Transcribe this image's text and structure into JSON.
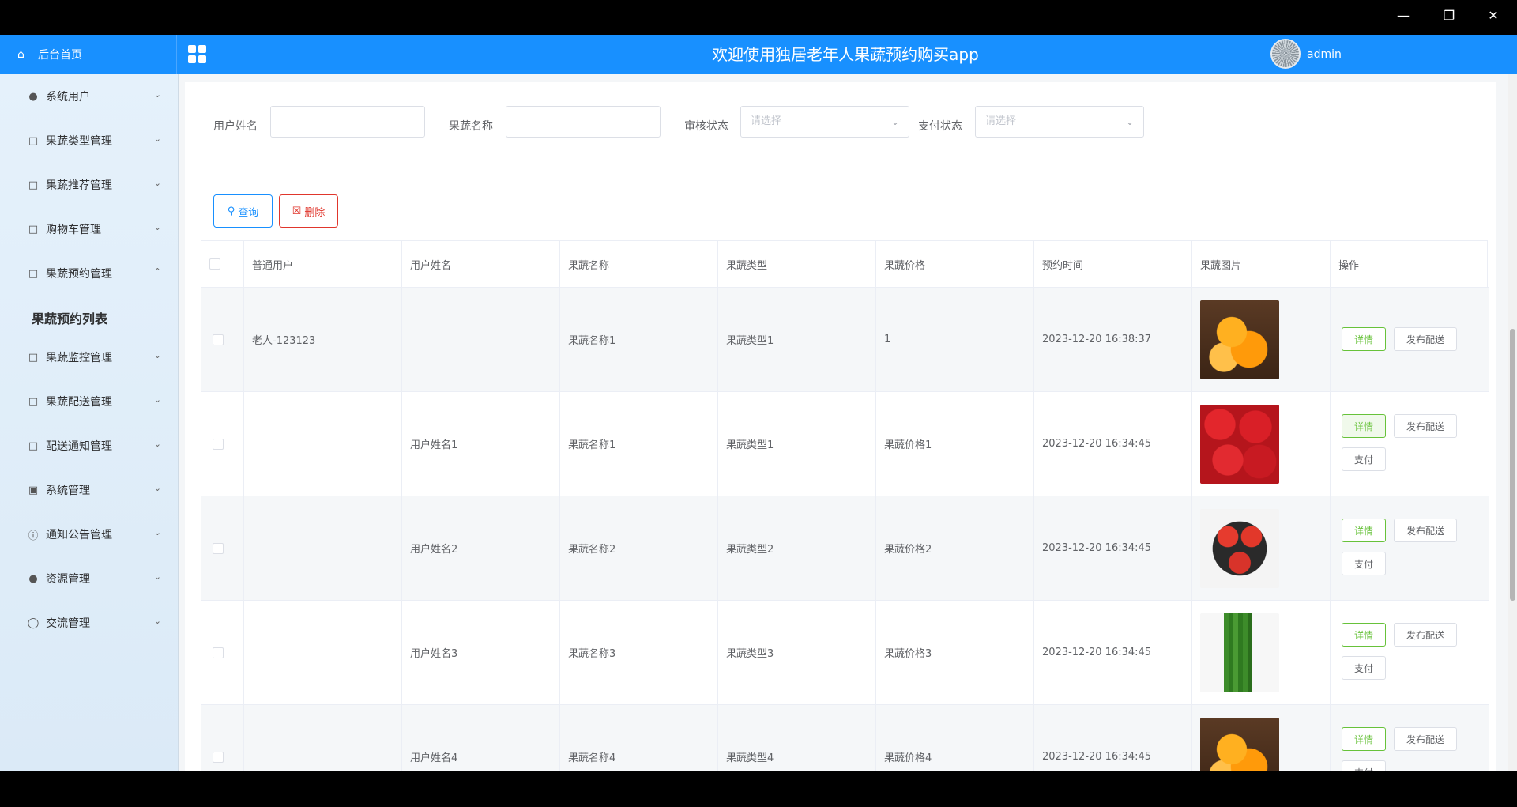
{
  "header": {
    "home_label": "后台首页",
    "title": "欢迎使用独居老年人果蔬预约购买app",
    "user": "admin"
  },
  "sidebar": {
    "items": [
      {
        "label": "系统用户",
        "icon": "user-icon"
      },
      {
        "label": "果蔬类型管理",
        "icon": "doc-icon"
      },
      {
        "label": "果蔬推荐管理",
        "icon": "doc-icon"
      },
      {
        "label": "购物车管理",
        "icon": "doc-icon"
      },
      {
        "label": "果蔬预约管理",
        "icon": "doc-icon",
        "expanded": true
      },
      {
        "label": "果蔬监控管理",
        "icon": "doc-icon"
      },
      {
        "label": "果蔬配送管理",
        "icon": "doc-icon"
      },
      {
        "label": "配送通知管理",
        "icon": "doc-icon"
      },
      {
        "label": "系统管理",
        "icon": "picture-icon"
      },
      {
        "label": "通知公告管理",
        "icon": "info-icon"
      },
      {
        "label": "资源管理",
        "icon": "bulb-icon"
      },
      {
        "label": "交流管理",
        "icon": "chat-icon"
      }
    ],
    "active_sub": "果蔬预约列表"
  },
  "filters": {
    "username_label": "用户姓名",
    "produce_name_label": "果蔬名称",
    "review_label": "审核状态",
    "review_placeholder": "请选择",
    "pay_label": "支付状态",
    "pay_placeholder": "请选择"
  },
  "buttons": {
    "query": "查询",
    "delete": "删除"
  },
  "table": {
    "headers": [
      "普通用户",
      "用户姓名",
      "果蔬名称",
      "果蔬类型",
      "果蔬价格",
      "预约时间",
      "果蔬图片",
      "操作"
    ],
    "rows": [
      {
        "user": "老人-123123",
        "name": "",
        "produce": "果蔬名称1",
        "type": "果蔬类型1",
        "price": "1",
        "time": "2023-12-20 16:38:37",
        "image": "orange",
        "pay": false
      },
      {
        "user": "",
        "name": "用户姓名1",
        "produce": "果蔬名称1",
        "type": "果蔬类型1",
        "price": "果蔬价格1",
        "time": "2023-12-20 16:34:45",
        "image": "red-pepper",
        "pay": true
      },
      {
        "user": "",
        "name": "用户姓名2",
        "produce": "果蔬名称2",
        "type": "果蔬类型2",
        "price": "果蔬价格2",
        "time": "2023-12-20 16:34:45",
        "image": "tomato",
        "pay": true
      },
      {
        "user": "",
        "name": "用户姓名3",
        "produce": "果蔬名称3",
        "type": "果蔬类型3",
        "price": "果蔬价格3",
        "time": "2023-12-20 16:34:45",
        "image": "okra",
        "pay": true
      },
      {
        "user": "",
        "name": "用户姓名4",
        "produce": "果蔬名称4",
        "type": "果蔬类型4",
        "price": "果蔬价格4",
        "time": "2023-12-20 16:34:45",
        "image": "orange",
        "pay": true
      }
    ],
    "action_detail": "详情",
    "action_publish": "发布配送",
    "action_pay": "支付"
  },
  "colors": {
    "primary": "#1890ff",
    "danger": "#e0362c",
    "success": "#67c23a"
  }
}
